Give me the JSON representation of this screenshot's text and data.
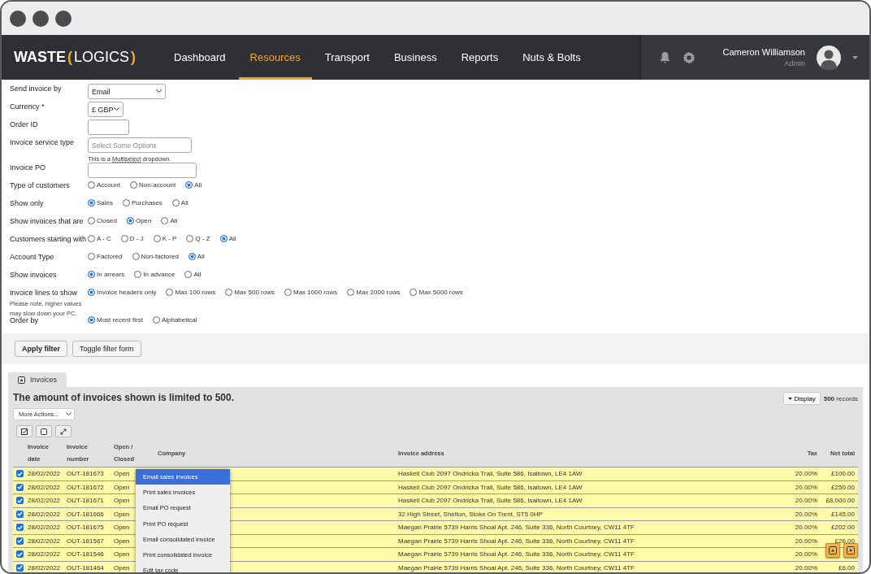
{
  "nav": {
    "logo": {
      "text_a": "WASTE",
      "bracket_open": "(",
      "text_b": "LOGICS",
      "bracket_close": ")"
    },
    "items": [
      {
        "label": "Dashboard",
        "selected": false
      },
      {
        "label": "Resources",
        "selected": true
      },
      {
        "label": "Transport",
        "selected": false
      },
      {
        "label": "Business",
        "selected": false
      },
      {
        "label": "Reports",
        "selected": false
      },
      {
        "label": "Nuts & Bolts",
        "selected": false
      }
    ],
    "user": {
      "name": "Cameron Williamson",
      "role": "Admin"
    }
  },
  "form": {
    "fields": [
      {
        "kind": "select",
        "label": "Send invoice by",
        "value": "Email"
      },
      {
        "kind": "select",
        "label": "Currency *",
        "value": "£ GBP"
      },
      {
        "kind": "input",
        "label": "Order ID"
      },
      {
        "kind": "input",
        "label": "Invoice service type",
        "placeholder": "Select Some Options",
        "help_before": "This is a ",
        "help_link": "Multiselect",
        "help_after": " dropdown."
      },
      {
        "kind": "input",
        "label": "Invoice PO"
      },
      {
        "kind": "radio",
        "label": "Type of customers",
        "options": [
          {
            "label": "Account",
            "selected": false
          },
          {
            "label": "Non-account",
            "selected": false
          },
          {
            "label": "All",
            "selected": true
          }
        ]
      },
      {
        "kind": "radio",
        "label": "Show only",
        "options": [
          {
            "label": "Sales",
            "selected": true
          },
          {
            "label": "Purchases",
            "selected": false
          },
          {
            "label": "All",
            "selected": false
          }
        ]
      },
      {
        "kind": "radio",
        "label": "Show invoices that are",
        "options": [
          {
            "label": "Closed",
            "selected": false
          },
          {
            "label": "Open",
            "selected": true
          },
          {
            "label": "All",
            "selected": false
          }
        ]
      },
      {
        "kind": "radio",
        "label": "Customers starting with",
        "options": [
          {
            "label": "A - C",
            "selected": false
          },
          {
            "label": "D - J",
            "selected": false
          },
          {
            "label": "K - P",
            "selected": false
          },
          {
            "label": "Q - Z",
            "selected": false
          },
          {
            "label": "All",
            "selected": true
          }
        ]
      },
      {
        "kind": "radio",
        "label": "Account Type",
        "options": [
          {
            "label": "Factored",
            "selected": false
          },
          {
            "label": "Non-factored",
            "selected": false
          },
          {
            "label": "All",
            "selected": true
          }
        ]
      },
      {
        "kind": "radio",
        "label": "Show invoices",
        "options": [
          {
            "label": "In arrears",
            "selected": true
          },
          {
            "label": "In advance",
            "selected": false
          },
          {
            "label": "All",
            "selected": false
          }
        ]
      },
      {
        "kind": "radio",
        "label": "Invoice lines to show",
        "note": "Please note, higher values may slow down your PC.",
        "options": [
          {
            "label": "Invoice headers only",
            "selected": true
          },
          {
            "label": "Max 100 rows",
            "selected": false
          },
          {
            "label": "Max 500 rows",
            "selected": false
          },
          {
            "label": "Max 1000 rows",
            "selected": false
          },
          {
            "label": "Max 2000 rows",
            "selected": false
          },
          {
            "label": "Max 5000 rows",
            "selected": false
          }
        ]
      },
      {
        "kind": "radio",
        "label": "Order by",
        "options": [
          {
            "label": "Most recent first",
            "selected": true
          },
          {
            "label": "Alphabetical",
            "selected": false
          }
        ]
      }
    ],
    "buttons": [
      {
        "label": "Apply filter",
        "primary": true
      },
      {
        "label": "Toggle filter form",
        "primary": false
      }
    ]
  },
  "invoices": {
    "tab": "Invoices",
    "heading": "The amount of invoices shown is limited to 500.",
    "more_actions": "More Actions...",
    "display": "Display",
    "records_count": "500",
    "records_label": "records",
    "columns": [
      "Invoice date",
      "Invoice number",
      "Open / Closed",
      "Company",
      "Invoice address",
      "Tax",
      "Net total"
    ],
    "rows": [
      {
        "checked": true,
        "date": "28/02/2022",
        "number": "OUT-181673",
        "status": "Open",
        "address": "Haskell Club 2097 Ondricka Trail, Suite 586, Isaitown, LE4 1AW",
        "tax": "20.00%",
        "net_total": "£100.00"
      },
      {
        "checked": true,
        "date": "28/02/2022",
        "number": "OUT-181672",
        "status": "Open",
        "address": "Haskell Club 2097 Ondricka Trail, Suite 586, Isaitown, LE4 1AW",
        "tax": "20.00%",
        "net_total": "£250.00"
      },
      {
        "checked": true,
        "date": "28/02/2022",
        "number": "OUT-181671",
        "status": "Open",
        "address": "Haskell Club 2097 Ondricka Trail, Suite 586, Isaitown, LE4 1AW",
        "tax": "20.00%",
        "net_total": "£8,000.00"
      },
      {
        "checked": true,
        "date": "28/02/2022",
        "number": "OUT-181666",
        "status": "Open",
        "address": "32 High Street, Shelton, Stoke On Trent, ST5 0HP",
        "tax": "20.00%",
        "net_total": "£145.00"
      },
      {
        "checked": true,
        "date": "28/02/2022",
        "number": "OUT-181675",
        "status": "Open",
        "address": "Maegan Prairie 5739 Harris Shoal Apt. 246, Suite 336, North Courtney, CW11 4TF",
        "tax": "20.00%",
        "net_total": "£202.00"
      },
      {
        "checked": true,
        "date": "28/02/2022",
        "number": "OUT-181567",
        "status": "Open",
        "address": "Maegan Prairie 5739 Harris Shoal Apt. 246, Suite 336, North Courtney, CW11 4TF",
        "tax": "20.00%",
        "net_total": "£26.00"
      },
      {
        "checked": true,
        "date": "28/02/2022",
        "number": "OUT-181546",
        "status": "Open",
        "address": "Maegan Prairie 5739 Harris Shoal Apt. 246, Suite 336, North Courtney, CW11 4TF",
        "tax": "20.00%"
      },
      {
        "checked": true,
        "date": "28/02/2022",
        "number": "OUT-181464",
        "status": "Open",
        "address": "Maegan Prairie 5739 Harris Shoal Apt. 246, Suite 336, North Courtney, CW11 4TF",
        "tax": "20.00%",
        "net_total": "£6.00"
      }
    ]
  },
  "context_menu": {
    "items": [
      {
        "label": "Email sales invoices",
        "selected": true
      },
      {
        "label": "Print sales invoices",
        "selected": false
      },
      {
        "label": "Email PO request",
        "selected": false
      },
      {
        "label": "Print PO request",
        "selected": false
      },
      {
        "label": "Email consolidated invoice",
        "selected": false
      },
      {
        "label": "Print consolidated invoice",
        "selected": false
      },
      {
        "label": "Edit tax code",
        "selected": false
      }
    ]
  }
}
